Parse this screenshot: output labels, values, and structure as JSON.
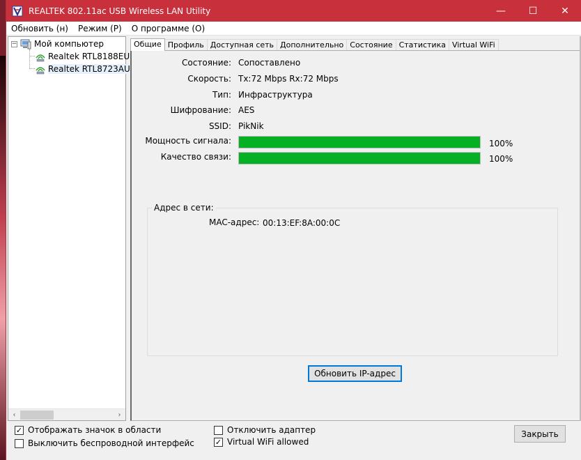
{
  "window": {
    "title": "REALTEK 802.11ac USB Wireless LAN Utility",
    "controls": {
      "minimize": "—",
      "maximize": "☐",
      "close": "✕"
    }
  },
  "menu": [
    {
      "label": "Обновить (н)"
    },
    {
      "label": "Режим (Р)"
    },
    {
      "label": "О программе (О)"
    }
  ],
  "tree": {
    "root_label": "Мой компьютер",
    "expander": "−",
    "adapters": [
      {
        "label": "Realtek RTL8188EU",
        "selected": false
      },
      {
        "label": "Realtek RTL8723AU",
        "selected": true
      }
    ]
  },
  "tabs": [
    {
      "label": "Общие",
      "active": true
    },
    {
      "label": "Профиль",
      "active": false
    },
    {
      "label": "Доступная сеть",
      "active": false
    },
    {
      "label": "Дополнительно",
      "active": false
    },
    {
      "label": "Состояние",
      "active": false
    },
    {
      "label": "Статистика",
      "active": false
    },
    {
      "label": "Virtual WiFi",
      "active": false
    }
  ],
  "general": {
    "status": {
      "label": "Состояние:",
      "value": "Сопоставлено"
    },
    "speed": {
      "label": "Скорость:",
      "value": "Tx:72 Mbps Rx:72 Mbps"
    },
    "type": {
      "label": "Тип:",
      "value": "Инфраструктура"
    },
    "encryption": {
      "label": "Шифрование:",
      "value": "AES"
    },
    "ssid": {
      "label": "SSID:",
      "value": "PikNik"
    },
    "signal": {
      "label": "Мощность сигнала:",
      "percent_text": "100%",
      "level": 1.0
    },
    "quality": {
      "label": "Качество связи:",
      "percent_text": "100%",
      "level": 1.0
    },
    "bar_color": "#06b025",
    "network_address": {
      "group_label": "Адрес в сети:",
      "mac_label": "MAC-адрес:",
      "mac_value": "00:13:EF:8A:00:0C"
    },
    "renew_button": "Обновить IP-адрес"
  },
  "bottom": {
    "show_tray_icon": {
      "label": "Отображать значок в области",
      "checked": true
    },
    "disable_wireless": {
      "label": "Выключить беспроводной интерфейс",
      "checked": false
    },
    "disable_adapter": {
      "label": "Отключить адаптер",
      "checked": false
    },
    "virtual_wifi": {
      "label": "Virtual WiFi allowed",
      "checked": true
    },
    "close_button": "Закрыть"
  },
  "colors": {
    "titlebar": "#c8303c"
  }
}
